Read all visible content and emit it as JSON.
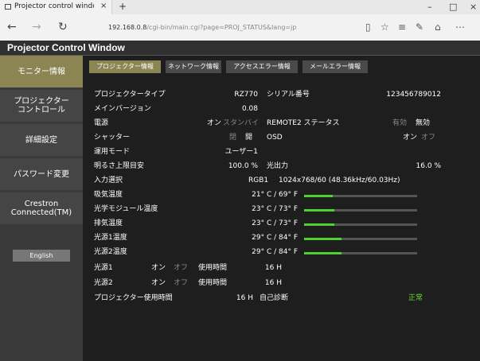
{
  "browser": {
    "tab_title": "Projector control windo",
    "new_tab": "+",
    "win_min": "–",
    "win_max": "□",
    "win_close": "×",
    "nav_back": "←",
    "nav_forward": "→",
    "nav_refresh": "↻",
    "url_host": "192.168.0.8",
    "url_rest": "/cgi-bin/main.cgi?page=PROJ_STATUS&lang=jp",
    "icons": [
      "reading-view-icon",
      "star-icon",
      "hub-icon",
      "note-icon",
      "share-icon",
      "more-icon"
    ]
  },
  "header": {
    "title": "Projector Control Window"
  },
  "sidebar": {
    "items": [
      {
        "label": "モニター情報",
        "active": true
      },
      {
        "label_line1": "プロジェクター",
        "label_line2": "コントロール"
      },
      {
        "label": "詳細設定"
      },
      {
        "label": "パスワード変更"
      },
      {
        "label_line1": "Crestron",
        "label_line2": "Connected(TM)"
      }
    ],
    "english": "English"
  },
  "tabs": [
    {
      "label": "プロジェクター情報",
      "active": true
    },
    {
      "label": "ネットワーク情報"
    },
    {
      "label": "アクセスエラー情報"
    },
    {
      "label": "メールエラー情報"
    }
  ],
  "info": {
    "type_label": "プロジェクタータイプ",
    "type_value": "RZ770",
    "serial_label": "シリアル番号",
    "serial_value": "123456789012",
    "version_label": "メインバージョン",
    "version_value": "0.08",
    "power_label": "電源",
    "power_on": "オン",
    "power_standby": "スタンバイ",
    "remote2_label": "REMOTE2 ステータス",
    "remote2_enabled": "有効",
    "remote2_disabled": "無効",
    "shutter_label": "シャッター",
    "shutter_closed": "閉",
    "shutter_open": "開",
    "osd_label": "OSD",
    "osd_on": "オン",
    "osd_off": "オフ",
    "mode_label": "運用モード",
    "mode_value": "ユーザー1",
    "brightness_label": "明るさ上限目安",
    "brightness_value": "100.0 %",
    "light_label": "光出力",
    "light_value": "16.0 %",
    "input_label": "入力選択",
    "input_value": "RGB1",
    "input_signal": "1024x768/60 (48.36kHz/60.03Hz)",
    "temps": [
      {
        "label": "吸気温度",
        "value": "21° C / 69° F",
        "level": 0.25
      },
      {
        "label": "光学モジュール温度",
        "value": "23° C / 73° F",
        "level": 0.27
      },
      {
        "label": "排気温度",
        "value": "23° C / 73° F",
        "level": 0.27
      },
      {
        "label": "光源1温度",
        "value": "29° C / 84° F",
        "level": 0.33
      },
      {
        "label": "光源2温度",
        "value": "29° C / 84° F",
        "level": 0.33
      }
    ],
    "light_sources": [
      {
        "label": "光源1",
        "on": "オン",
        "off": "オフ",
        "hours_label": "使用時間",
        "hours": "16 H"
      },
      {
        "label": "光源2",
        "on": "オン",
        "off": "オフ",
        "hours_label": "使用時間",
        "hours": "16 H"
      }
    ],
    "proj_hours_label": "プロジェクター使用時間",
    "proj_hours_value": "16 H",
    "diag_label": "自己診断",
    "diag_value": "正常"
  }
}
